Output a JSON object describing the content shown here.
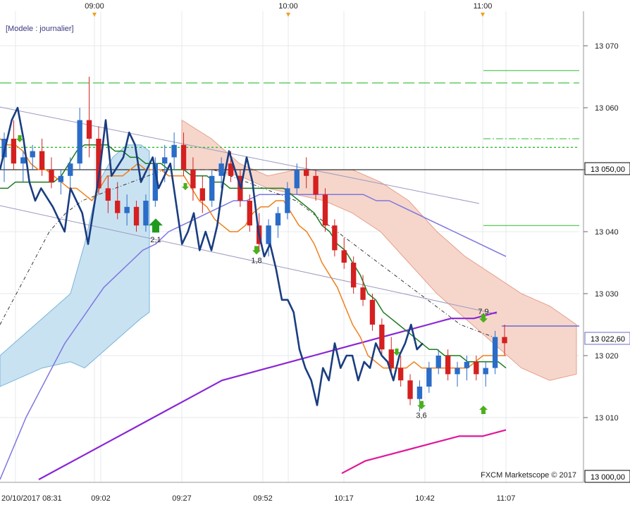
{
  "chart_data": {
    "type": "line",
    "model_label": "[Modele : journalier]",
    "watermark": "FXCM Marketscope © 2017",
    "colors": {
      "bull": "#2a6cc8",
      "bear": "#d42020",
      "close_line": "#1a3d80",
      "ma_fast": "#ef7f1a",
      "ma_slow": "#1e7a1e",
      "kumo_bull": "#c8e2f2",
      "kumo_bear": "#f6d6cb",
      "ma_blue": "#7d76e0",
      "ma_purple": "#8a26d6",
      "ma_magenta": "#e0189a",
      "level_green": "#2ebd2e",
      "channel": "#9a9ac2",
      "signal_green": "#4caf1e"
    },
    "x_time_labels": [
      "20/10/2017 08:31",
      "09:02",
      "09:27",
      "09:52",
      "10:17",
      "10:42",
      "11:07"
    ],
    "top_time_labels": [
      "09:00",
      "10:00",
      "11:00"
    ],
    "y_axis": {
      "ticks": [
        13010,
        13020,
        13030,
        13040,
        13050,
        13060,
        13070
      ],
      "tick_labels": [
        "13 010",
        "13 020",
        "13 030",
        "13 040",
        "13 050",
        "13 060",
        "13 070"
      ],
      "ylim": [
        13000,
        13075
      ],
      "bottom_tag": "13 000,00",
      "price_tags": [
        {
          "value": 13050,
          "label": "13 050,00"
        },
        {
          "value": 13022.6,
          "label": "13 022,60"
        }
      ]
    },
    "annotations": [
      {
        "label": "2,1",
        "direction": "up",
        "x_time": "09:18",
        "y": 13041
      },
      {
        "label": "1,8",
        "direction": "down",
        "x_time": "09:52",
        "y": 13037
      },
      {
        "label": "3,6",
        "direction": "down",
        "x_time": "10:41",
        "y": 13012
      },
      {
        "label": "7,9",
        "direction": "down",
        "x_time": "11:02",
        "y": 13026
      },
      {
        "label": "",
        "direction": "up",
        "x_time": "11:02",
        "y": 13012
      }
    ],
    "levels": [
      {
        "name": "",
        "value": 13064,
        "style": "dashed-green"
      },
      {
        "name": "",
        "value": 13053.6,
        "style": "dotted-green"
      },
      {
        "name": "",
        "value": 13050,
        "style": "solid-black"
      },
      {
        "name": "",
        "value": 13066,
        "style": "solid-green-short"
      },
      {
        "name": "",
        "value": 13055,
        "style": "dashdot-green-short"
      },
      {
        "name": "",
        "value": 13041,
        "style": "solid-green-short"
      },
      {
        "name": "",
        "value": 13025,
        "style": "solid-blue-short"
      }
    ],
    "series": [
      {
        "key": "close",
        "x": [
          0.0,
          0.02,
          0.03,
          0.04,
          0.05,
          0.06,
          0.07,
          0.09,
          0.1,
          0.11,
          0.12,
          0.14,
          0.15,
          0.17,
          0.18,
          0.19,
          0.21,
          0.22,
          0.23,
          0.24,
          0.25,
          0.26,
          0.27,
          0.28,
          0.29,
          0.31,
          0.32,
          0.33,
          0.34,
          0.35,
          0.36,
          0.37,
          0.38,
          0.39,
          0.4,
          0.41,
          0.42,
          0.43,
          0.44,
          0.45,
          0.46,
          0.47,
          0.48,
          0.49,
          0.5,
          0.51,
          0.52,
          0.53,
          0.54,
          0.55,
          0.56,
          0.57,
          0.58,
          0.59,
          0.6,
          0.61,
          0.62,
          0.63,
          0.64,
          0.65,
          0.66,
          0.67,
          0.68,
          0.69,
          0.7,
          0.71,
          0.72
        ],
        "values": [
          13050,
          13058,
          13060,
          13055,
          13048,
          13045,
          13047,
          13044,
          13042,
          13040,
          13047,
          13043,
          13038,
          13050,
          13058,
          13049,
          13052,
          13056,
          13054,
          13048,
          13050,
          13052,
          13047,
          13049,
          13051,
          13038,
          13040,
          13043,
          13037,
          13040,
          13037,
          13041,
          13048,
          13053,
          13050,
          13047,
          13052,
          13048,
          13040,
          13036,
          13038,
          13034,
          13029,
          13029,
          13027,
          13021,
          13018,
          13016,
          13012,
          13018,
          13016,
          13022,
          13018,
          13020,
          13020,
          13016,
          13019,
          13018,
          13022,
          13020,
          13019,
          13016,
          13020,
          13022,
          13025,
          13021,
          13022
        ]
      },
      {
        "key": "ma_fast",
        "values": [
          13055,
          13054,
          13054,
          13053,
          13051,
          13050,
          13050,
          13049,
          13048,
          13047,
          13047,
          13046,
          13045,
          13047,
          13049,
          13049,
          13049,
          13050,
          13051,
          13050,
          13050,
          13050,
          13049,
          13049,
          13049,
          13047,
          13045,
          13044,
          13042,
          13041,
          13040,
          13040,
          13041,
          13043,
          13044,
          13044,
          13045,
          13045,
          13043,
          13041,
          13040,
          13038,
          13035,
          13033,
          13031,
          13028,
          13025,
          13023,
          13020,
          13019,
          13018,
          13018,
          13018,
          13018,
          13019,
          13018,
          13018,
          13018,
          13018,
          13018,
          13018,
          13018,
          13019,
          13020,
          13020,
          13020,
          13020
        ]
      },
      {
        "key": "ma_slow",
        "values": [
          13047,
          13047,
          13048,
          13048,
          13048,
          13048,
          13048,
          13048,
          13049,
          13051,
          13053,
          13054,
          13054,
          13054,
          13054,
          13053,
          13053,
          13052,
          13052,
          13051,
          13051,
          13051,
          13050,
          13050,
          13050,
          13049,
          13049,
          13049,
          13048,
          13048,
          13047,
          13047,
          13047,
          13047,
          13047,
          13047,
          13047,
          13047,
          13046,
          13045,
          13044,
          13043,
          13041,
          13040,
          13038,
          13037,
          13035,
          13033,
          13030,
          13029,
          13027,
          13026,
          13025,
          13024,
          13023,
          13022,
          13021,
          13021,
          13020,
          13020,
          13020,
          13019,
          13019,
          13019,
          13019,
          13019,
          13018
        ]
      },
      {
        "key": "ma_blue",
        "values": [
          13000,
          13005,
          13010,
          13014,
          13018,
          13022,
          13025,
          13028,
          13031,
          13033,
          13035,
          13037,
          13038,
          13040,
          13041,
          13042,
          13043,
          13044,
          13045,
          13045,
          13046,
          13046,
          13046,
          13046,
          13046,
          13046,
          13046,
          13046,
          13046,
          13045,
          13045,
          13044,
          13043,
          13042,
          13041,
          13040,
          13039,
          13038,
          13037,
          13036
        ]
      },
      {
        "key": "ma_purple",
        "values": [
          13000,
          13002,
          13004,
          13006,
          13008,
          13010,
          13012,
          13014,
          13016,
          13017,
          13018,
          13019,
          13020,
          13021,
          13022,
          13023,
          13024,
          13025,
          13026,
          13026,
          13027
        ]
      },
      {
        "key": "ma_magenta",
        "values": [
          13001,
          13003,
          13004,
          13005,
          13006,
          13007,
          13007,
          13008
        ]
      },
      {
        "key": "ma_dashed",
        "values": [
          13025,
          13030,
          13035,
          13040,
          13043,
          13045,
          13046,
          13047,
          13048,
          13049,
          13050,
          13050,
          13050,
          13050,
          13049,
          13048,
          13047,
          13046,
          13045,
          13043,
          13041,
          13039,
          13037,
          13035,
          13033,
          13031,
          13029,
          13027,
          13025,
          13024,
          13023
        ]
      }
    ],
    "candles": [
      [
        13052,
        13056,
        13048,
        13055
      ],
      [
        13055,
        13058,
        13050,
        13051
      ],
      [
        13051,
        13053,
        13048,
        13052
      ],
      [
        13052,
        13054,
        13050,
        13053
      ],
      [
        13053,
        13055,
        13049,
        13050
      ],
      [
        13050,
        13052,
        13047,
        13048
      ],
      [
        13048,
        13050,
        13046,
        13049
      ],
      [
        13049,
        13052,
        13047,
        13051
      ],
      [
        13051,
        13060,
        13050,
        13058
      ],
      [
        13058,
        13065,
        13052,
        13055
      ],
      [
        13055,
        13057,
        13046,
        13047
      ],
      [
        13047,
        13049,
        13043,
        13045
      ],
      [
        13045,
        13048,
        13042,
        13043
      ],
      [
        13043,
        13046,
        13041,
        13044
      ],
      [
        13044,
        13045,
        13040,
        13041
      ],
      [
        13041,
        13046,
        13040,
        13045
      ],
      [
        13045,
        13052,
        13044,
        13051
      ],
      [
        13051,
        13054,
        13048,
        13052
      ],
      [
        13052,
        13056,
        13050,
        13054
      ],
      [
        13054,
        13056,
        13049,
        13050
      ],
      [
        13050,
        13052,
        13045,
        13047
      ],
      [
        13047,
        13049,
        13043,
        13045
      ],
      [
        13045,
        13050,
        13044,
        13049
      ],
      [
        13049,
        13052,
        13047,
        13051
      ],
      [
        13051,
        13053,
        13048,
        13049
      ],
      [
        13049,
        13050,
        13044,
        13045
      ],
      [
        13045,
        13046,
        13040,
        13041
      ],
      [
        13041,
        13043,
        13037,
        13038
      ],
      [
        13038,
        13042,
        13036,
        13041
      ],
      [
        13041,
        13044,
        13039,
        13043
      ],
      [
        13043,
        13048,
        13042,
        13047
      ],
      [
        13047,
        13051,
        13046,
        13050
      ],
      [
        13050,
        13052,
        13047,
        13049
      ],
      [
        13049,
        13050,
        13045,
        13046
      ],
      [
        13046,
        13047,
        13040,
        13041
      ],
      [
        13041,
        13042,
        13036,
        13037
      ],
      [
        13037,
        13039,
        13034,
        13035
      ],
      [
        13035,
        13036,
        13030,
        13031
      ],
      [
        13031,
        13033,
        13028,
        13029
      ],
      [
        13029,
        13030,
        13024,
        13025
      ],
      [
        13025,
        13026,
        13020,
        13021
      ],
      [
        13021,
        13023,
        13017,
        13018
      ],
      [
        13018,
        13020,
        13015,
        13016
      ],
      [
        13016,
        13017,
        13012,
        13013
      ],
      [
        13013,
        13016,
        13011,
        13015
      ],
      [
        13015,
        13019,
        13014,
        13018
      ],
      [
        13018,
        13021,
        13017,
        13020
      ],
      [
        13020,
        13021,
        13016,
        13017
      ],
      [
        13017,
        13019,
        13015,
        13018
      ],
      [
        13018,
        13020,
        13016,
        13019
      ],
      [
        13019,
        13020,
        13016,
        13017
      ],
      [
        13017,
        13019,
        13015,
        13018
      ],
      [
        13018,
        13024,
        13017,
        13023
      ],
      [
        13023,
        13025,
        13020,
        13022
      ]
    ]
  }
}
